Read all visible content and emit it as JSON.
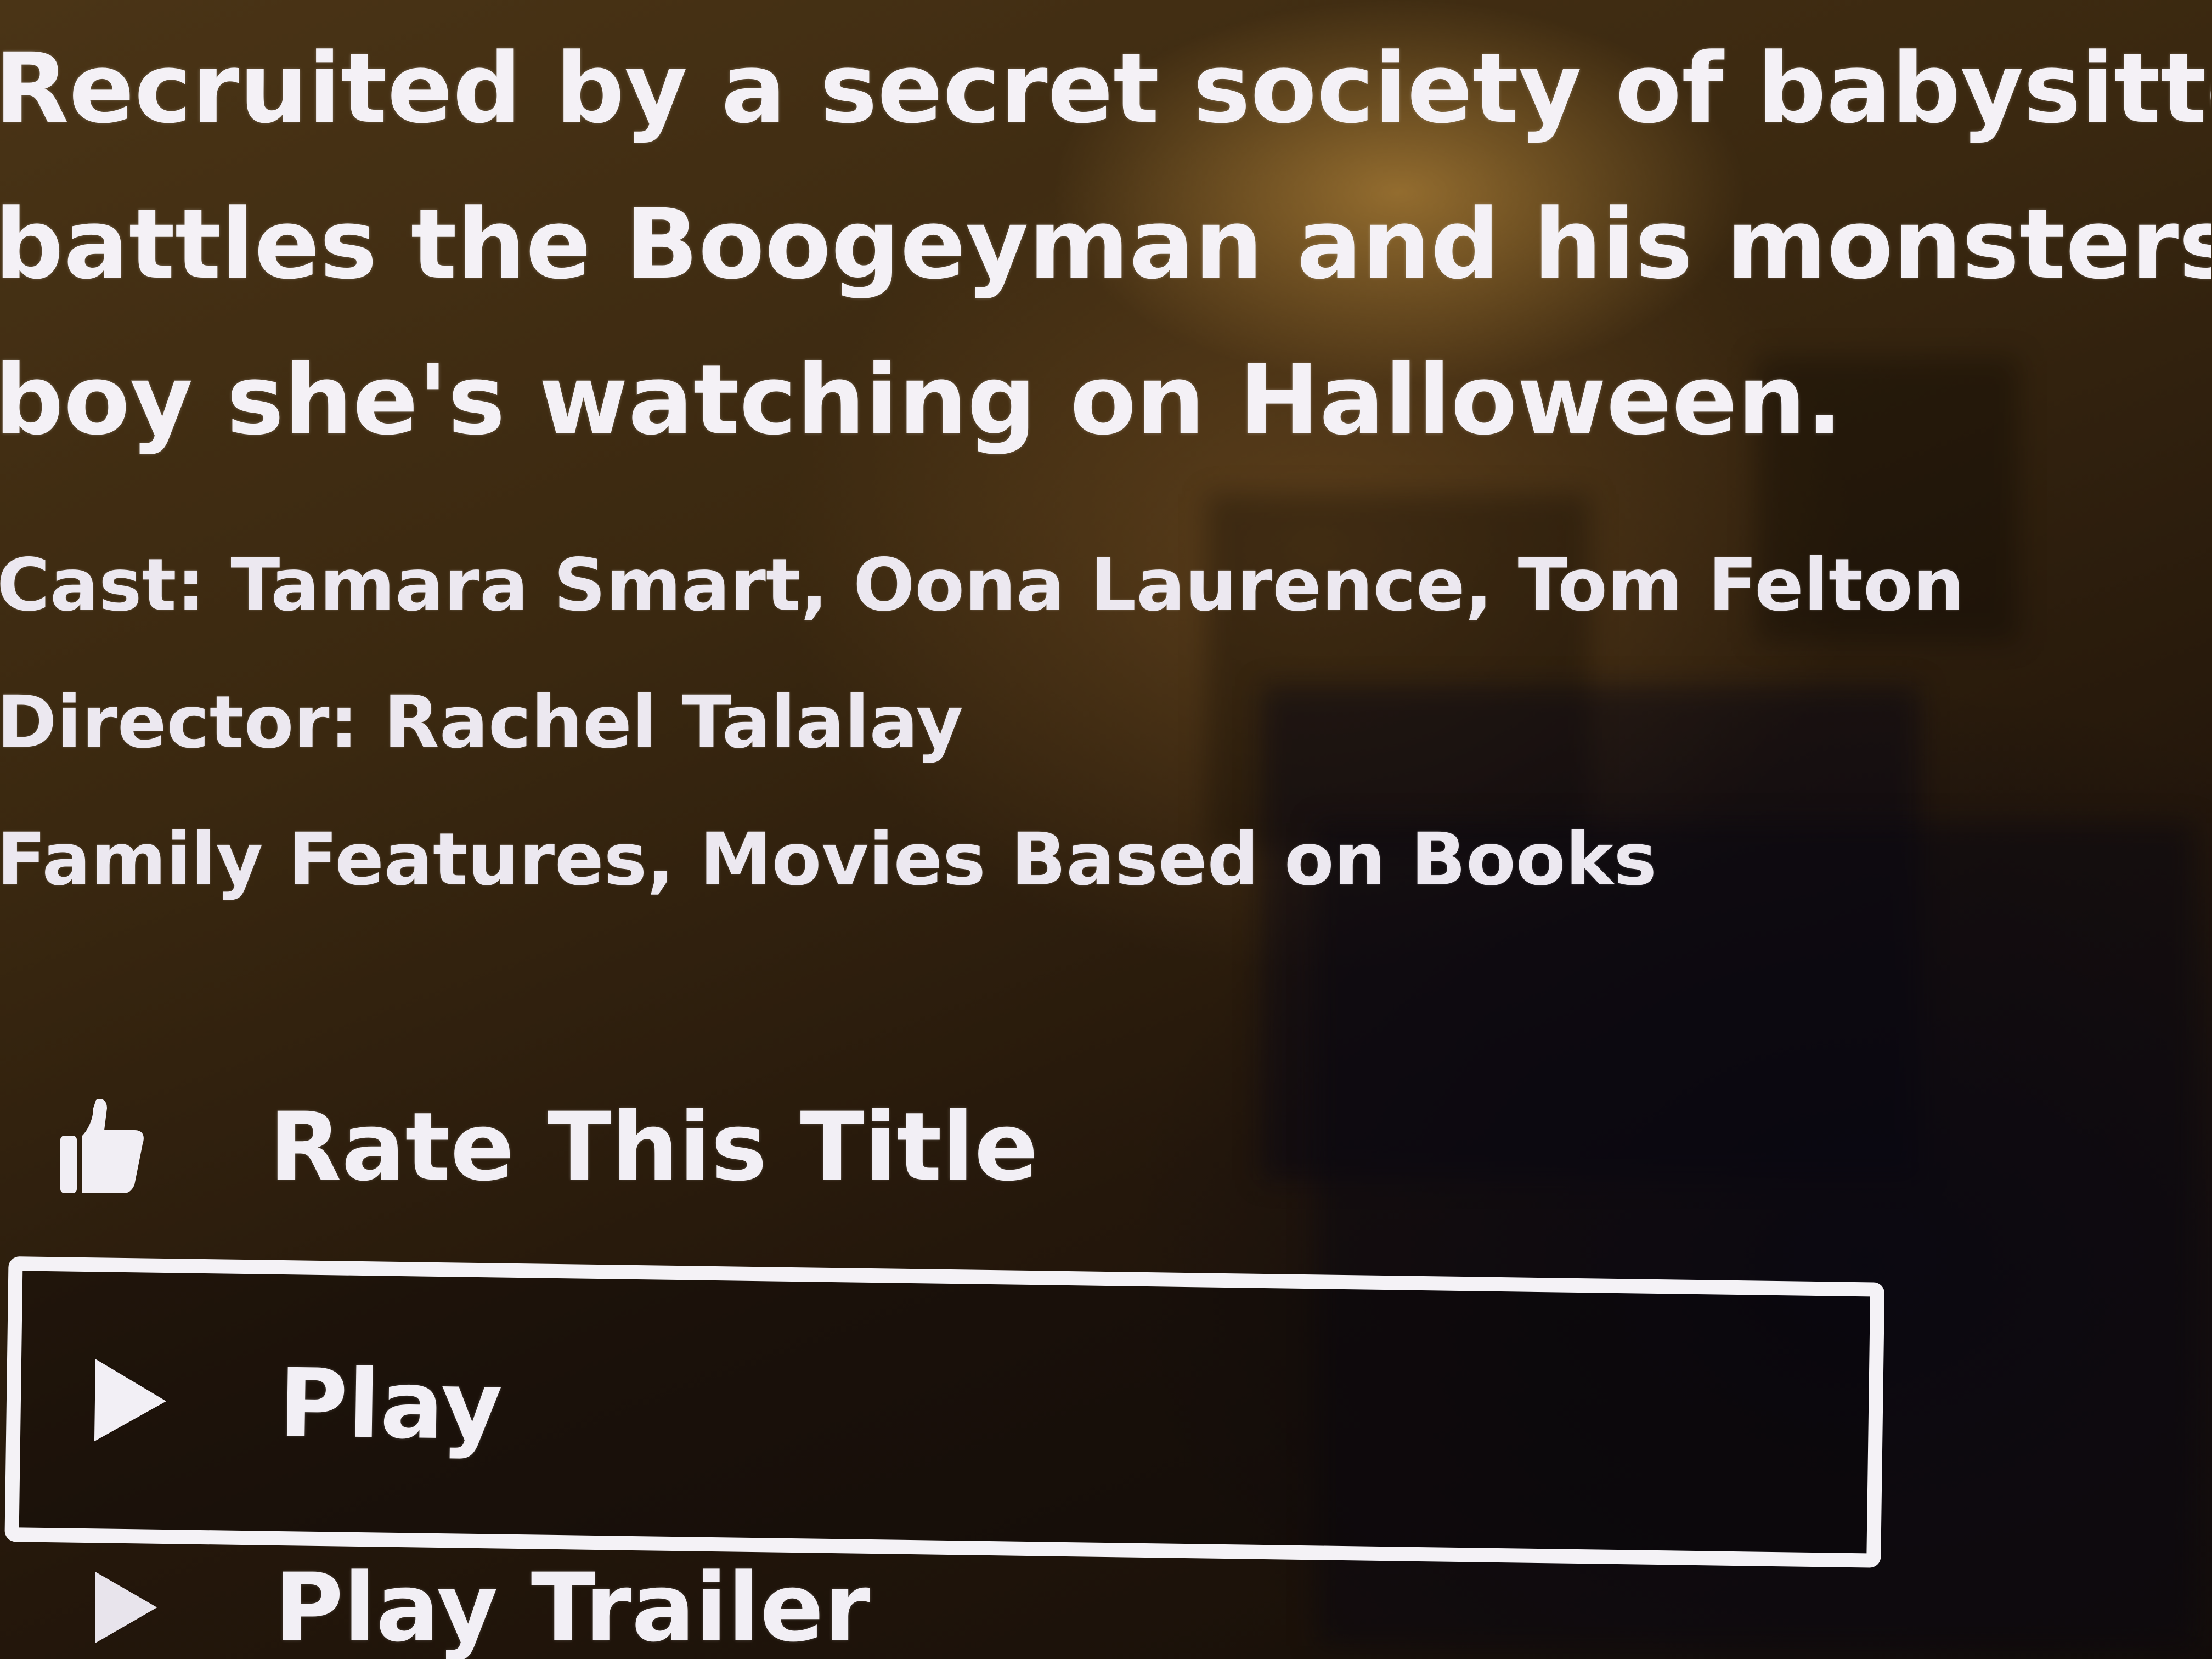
{
  "synopsis": {
    "line1": "Recruited by a secret society of babysitters,",
    "line2": "battles the Boogeyman and his monsters wh",
    "line3": "boy she's watching on Halloween."
  },
  "details": {
    "cast": "Cast: Tamara Smart, Oona Laurence, Tom Felton",
    "director": "Director: Rachel Talalay",
    "genres": "Family Features, Movies Based on Books"
  },
  "actions": {
    "rate_label": "Rate This Title",
    "rate_icon": "thumbs-up-icon",
    "play_label": "Play",
    "play_icon": "play-triangle-icon",
    "trailer_label": "Play Trailer",
    "trailer_icon": "play-triangle-icon",
    "focused": "Play"
  },
  "colors": {
    "text": "#f1eef4",
    "focus_outline": "#f4f2f6",
    "background": "#2a1c0e"
  }
}
